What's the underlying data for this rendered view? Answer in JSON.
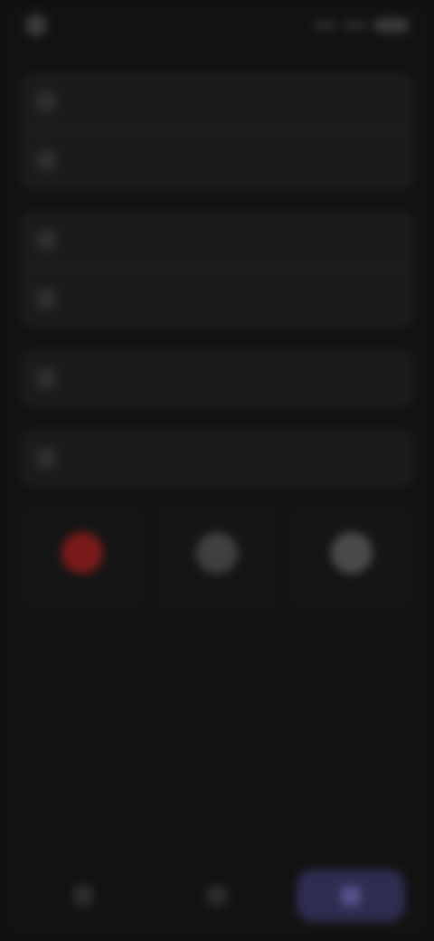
{
  "status_bar": {
    "time": ""
  },
  "page": {
    "title": ""
  },
  "sections": [
    {
      "header": "",
      "rows": [
        {
          "icon": "generic-icon",
          "label": ""
        },
        {
          "icon": "generic-icon",
          "label": ""
        }
      ]
    },
    {
      "header": "",
      "rows": [
        {
          "icon": "generic-icon",
          "label": ""
        },
        {
          "icon": "generic-icon",
          "label": ""
        }
      ]
    },
    {
      "header": "",
      "rows": [
        {
          "icon": "generic-icon",
          "label": ""
        }
      ]
    },
    {
      "header": "",
      "rows": [
        {
          "icon": "generic-icon",
          "label": ""
        }
      ]
    }
  ],
  "apps": {
    "header": "",
    "items": [
      {
        "name": "",
        "icon": "app-icon",
        "accent": "#7a1a1a"
      },
      {
        "name": "",
        "icon": "app-icon",
        "accent": "#3f3f3f"
      },
      {
        "name": "",
        "icon": "app-icon",
        "accent": "#4a4a4a"
      }
    ]
  },
  "bottom_nav": {
    "items": [
      {
        "icon": "nav-icon",
        "label": ""
      },
      {
        "icon": "nav-icon",
        "label": ""
      },
      {
        "icon": "nav-icon",
        "label": ""
      }
    ],
    "active_index": 2,
    "active_color": "#2e2c50"
  }
}
